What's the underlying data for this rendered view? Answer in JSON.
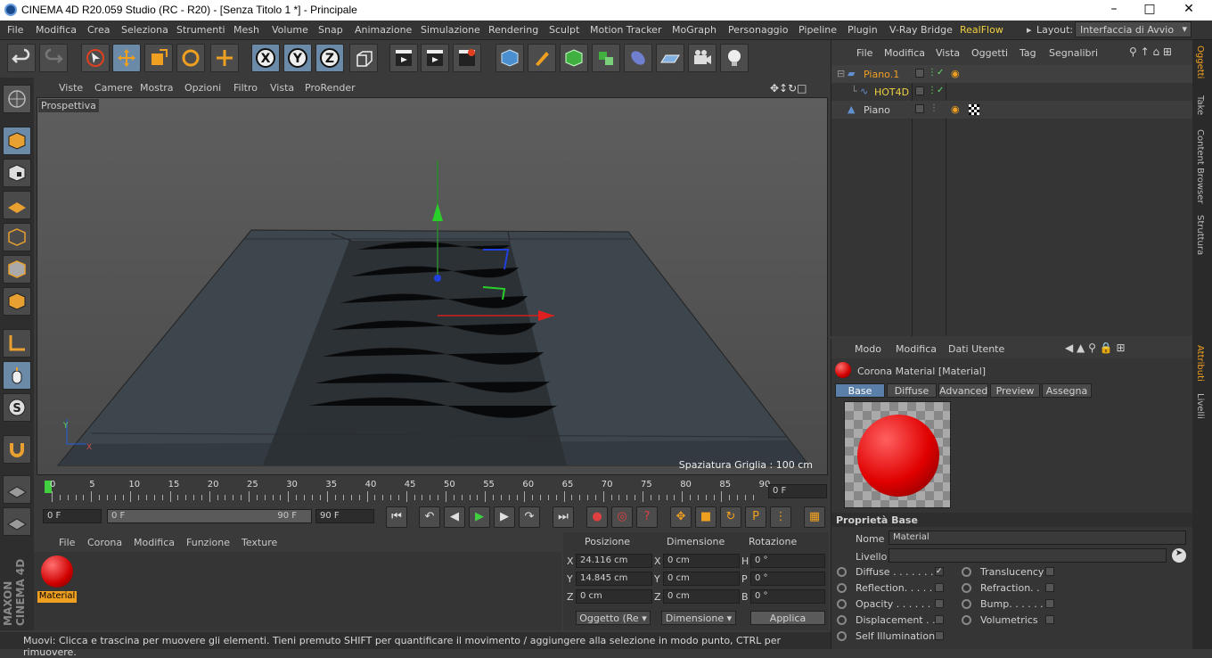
{
  "app": {
    "title": "CINEMA 4D R20.059 Studio (RC - R20) - [Senza Titolo 1 *] - Principale"
  },
  "menu": [
    "File",
    "Modifica",
    "Crea",
    "Seleziona",
    "Strumenti",
    "Mesh",
    "Volume",
    "Snap",
    "Animazione",
    "Simulazione",
    "Rendering",
    "Sculpt",
    "Motion Tracker",
    "MoGraph",
    "Personaggio",
    "Pipeline",
    "Plugin",
    "V-Ray Bridge",
    "RealFlow"
  ],
  "layout": {
    "label": "Layout:",
    "value": "Interfaccia di Avvio"
  },
  "viewport": {
    "menu": [
      "Viste",
      "Camere",
      "Mostra",
      "Opzioni",
      "Filtro",
      "Vista",
      "ProRender"
    ],
    "label": "Prospettiva",
    "grid_spacing": "Spaziatura Griglia : 100 cm",
    "axis_y": "Y",
    "axis_x": "X"
  },
  "timeline": {
    "ticks": [
      "0",
      "5",
      "10",
      "15",
      "20",
      "25",
      "30",
      "35",
      "40",
      "45",
      "50",
      "55",
      "60",
      "65",
      "70",
      "75",
      "80",
      "85",
      "90"
    ],
    "current": "0 F"
  },
  "transport": {
    "start": "0 F",
    "range_start": "0 F",
    "range_end": "90 F",
    "end": "90 F"
  },
  "materials": {
    "menu": [
      "File",
      "Corona",
      "Modifica",
      "Funzione",
      "Texture"
    ],
    "item": "Material"
  },
  "coords": {
    "headers": [
      "Posizione",
      "Dimensione",
      "Rotazione"
    ],
    "rows": [
      {
        "axis": "X",
        "pos": "24.116 cm",
        "daxis": "X",
        "dim": "0 cm",
        "raxis": "H",
        "rot": "0 °"
      },
      {
        "axis": "Y",
        "pos": "14.845 cm",
        "daxis": "Y",
        "dim": "0 cm",
        "raxis": "P",
        "rot": "0 °"
      },
      {
        "axis": "Z",
        "pos": "0 cm",
        "daxis": "Z",
        "dim": "0 cm",
        "raxis": "B",
        "rot": "0 °"
      }
    ],
    "mode": "Oggetto (Re",
    "dim_mode": "Dimensione",
    "apply": "Applica"
  },
  "objects": {
    "menu": [
      "File",
      "Modifica",
      "Vista",
      "Oggetti",
      "Tag",
      "Segnalibri"
    ],
    "items": [
      {
        "name": "Piano.1"
      },
      {
        "name": "HOT4D"
      },
      {
        "name": "Piano"
      }
    ]
  },
  "attributes": {
    "menu": [
      "Modo",
      "Modifica",
      "Dati Utente"
    ],
    "title": "Corona Material [Material]",
    "tabs": [
      "Base",
      "Diffuse",
      "Advanced",
      "Preview",
      "Assegna"
    ],
    "section": "Proprietà Base",
    "name_label": "Nome",
    "name_value": "Material",
    "level_label": "Livello",
    "left": [
      "Diffuse . . . . . . .",
      "Reflection. . . . .",
      "Opacity . . . . . .",
      "Displacement . .",
      "Self Illumination"
    ],
    "right": [
      "Translucency",
      "Refraction. .",
      "Bump. . . . . .",
      "Volumetrics"
    ]
  },
  "side_tabs": [
    "Oggetti",
    "Take",
    "Content Browser",
    "Struttura"
  ],
  "side_tabs2": [
    "Attributi",
    "Livelli"
  ],
  "status": "Muovi: Clicca e trascina per muovere gli elementi. Tieni premuto SHIFT per quantificare il movimento / aggiungere alla selezione in modo punto, CTRL per rimuovere.",
  "brand": "MAXON CINEMA 4D"
}
